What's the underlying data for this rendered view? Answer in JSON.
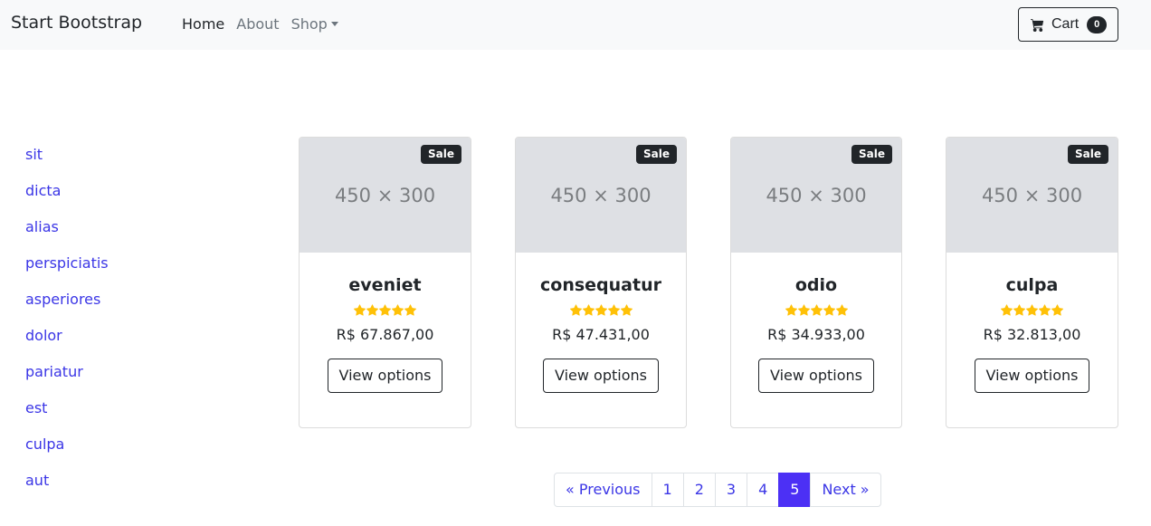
{
  "navbar": {
    "brand": "Start Bootstrap",
    "links": [
      {
        "label": "Home",
        "active": true
      },
      {
        "label": "About",
        "active": false
      },
      {
        "label": "Shop",
        "active": false,
        "dropdown": true
      }
    ],
    "cart": {
      "label": "Cart",
      "count": "0",
      "icon": "cart-icon"
    }
  },
  "sidebar": {
    "items": [
      "sit",
      "dicta",
      "alias",
      "perspiciatis",
      "asperiores",
      "dolor",
      "pariatur",
      "est",
      "culpa",
      "aut"
    ]
  },
  "products": [
    {
      "image_placeholder": "450 × 300",
      "badge": "Sale",
      "name": "eveniet",
      "rating": 5,
      "price": "R$ 67.867,00",
      "button": "View options"
    },
    {
      "image_placeholder": "450 × 300",
      "badge": "Sale",
      "name": "consequatur",
      "rating": 5,
      "price": "R$ 47.431,00",
      "button": "View options"
    },
    {
      "image_placeholder": "450 × 300",
      "badge": "Sale",
      "name": "odio",
      "rating": 5,
      "price": "R$ 34.933,00",
      "button": "View options"
    },
    {
      "image_placeholder": "450 × 300",
      "badge": "Sale",
      "name": "culpa",
      "rating": 5,
      "price": "R$ 32.813,00",
      "button": "View options"
    }
  ],
  "pagination": {
    "previous": "« Previous",
    "pages": [
      "1",
      "2",
      "3",
      "4",
      "5"
    ],
    "active_page": "5",
    "next": "Next »"
  },
  "colors": {
    "link": "#3b36e6",
    "active_page": "#4c30f5",
    "star": "#ffc107",
    "navbar_bg": "#f8f9fa",
    "dark": "#212529"
  }
}
